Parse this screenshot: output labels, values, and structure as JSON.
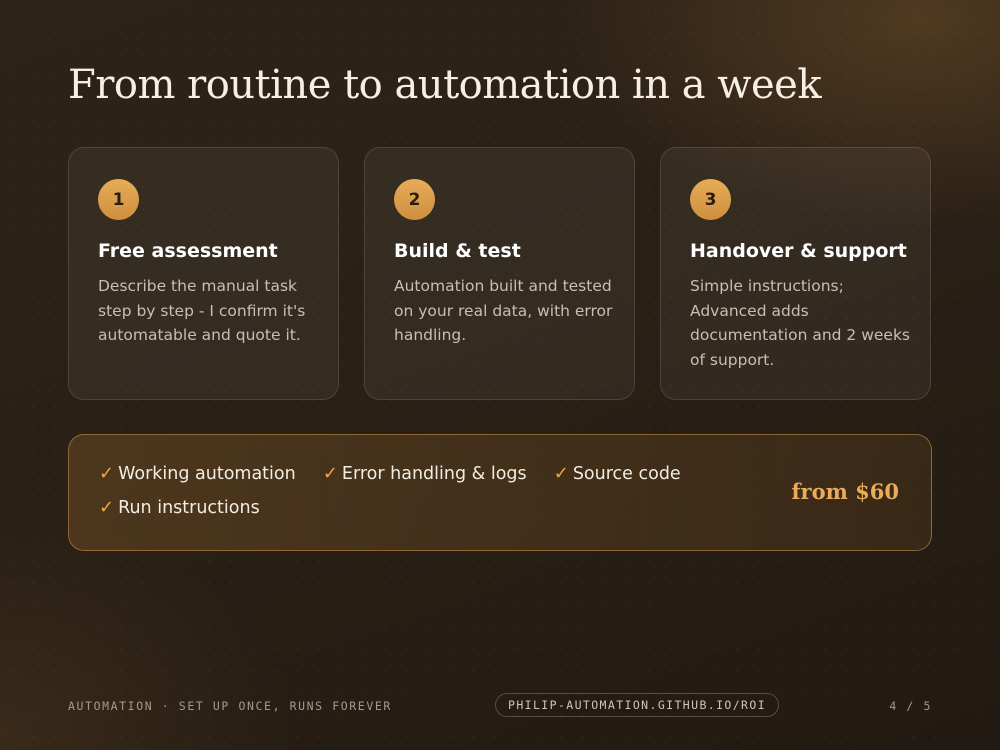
{
  "title": "From routine to automation in a week",
  "steps": [
    {
      "number": "1",
      "heading": "Free assessment",
      "text": "Describe the manual task step by step - I confirm it's automatable and quote it."
    },
    {
      "number": "2",
      "heading": "Build & test",
      "text": "Automation built and tested on your real data, with error handling."
    },
    {
      "number": "3",
      "heading": "Handover & support",
      "text": "Simple instructions; Advanced adds documentation and 2 weeks of support."
    }
  ],
  "deliverables": {
    "check_glyph": "✓",
    "items": [
      "Working automation",
      "Error handling & logs",
      "Source code",
      "Run instructions"
    ],
    "price": "from $60"
  },
  "footer": {
    "tagline": "AUTOMATION · SET UP ONCE, RUNS FOREVER",
    "link": "PHILIP-AUTOMATION.GITHUB.IO/ROI",
    "page": "4 / 5"
  },
  "colors": {
    "accent": "#e9ad5a",
    "background": "#2a2016",
    "card_border": "#4a3f33"
  }
}
